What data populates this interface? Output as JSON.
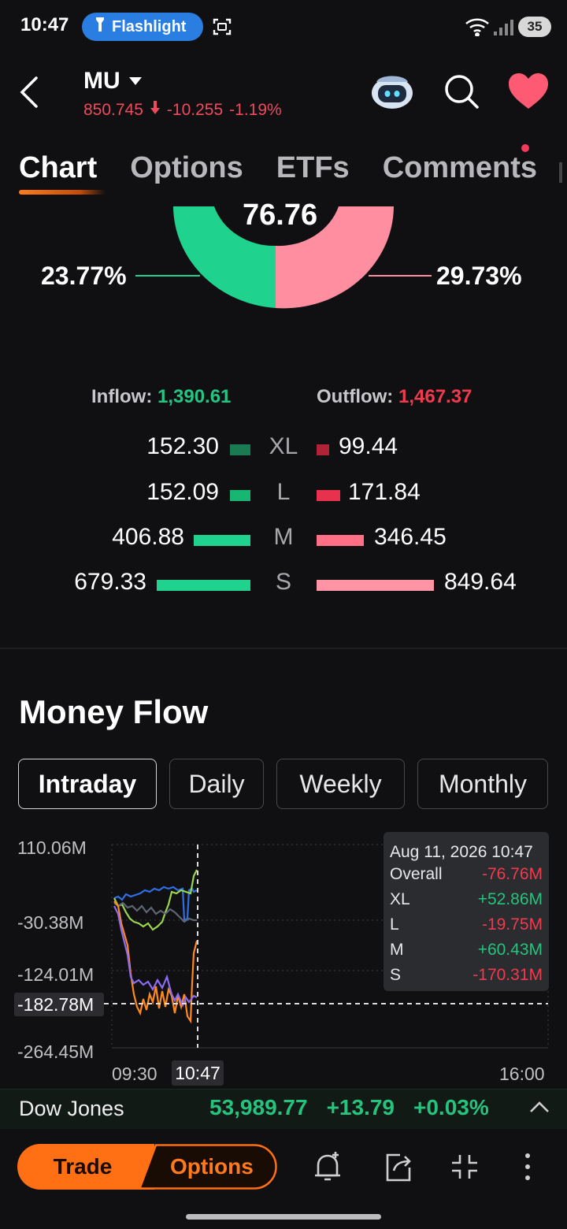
{
  "status_bar": {
    "time": "10:47",
    "flashlight_label": "Flashlight",
    "battery": "35"
  },
  "header": {
    "ticker": "MU",
    "price": "850.745",
    "change": "-10.255",
    "change_pct": "-1.19%",
    "icons": [
      "back-arrow-icon",
      "robot-assistant-icon",
      "search-icon",
      "heart-icon"
    ]
  },
  "tabs": [
    {
      "label": "Chart",
      "active": true
    },
    {
      "label": "Options",
      "active": false
    },
    {
      "label": "ETFs",
      "active": false
    },
    {
      "label": "Comments",
      "active": false,
      "badge": true
    }
  ],
  "donut": {
    "center_value": "76.76",
    "inflow_pct": "23.77%",
    "outflow_pct": "29.73%"
  },
  "flow_summary": {
    "inflow_label": "Inflow:",
    "inflow_value": "1,390.61",
    "outflow_label": "Outflow:",
    "outflow_value": "1,467.37",
    "rows": [
      {
        "size": "XL",
        "inflow": "152.30",
        "outflow": "99.44",
        "inflow_num": 152.3,
        "outflow_num": 99.44
      },
      {
        "size": "L",
        "inflow": "152.09",
        "outflow": "171.84",
        "inflow_num": 152.09,
        "outflow_num": 171.84
      },
      {
        "size": "M",
        "inflow": "406.88",
        "outflow": "346.45",
        "inflow_num": 406.88,
        "outflow_num": 346.45
      },
      {
        "size": "S",
        "inflow": "679.33",
        "outflow": "849.64",
        "inflow_num": 679.33,
        "outflow_num": 849.64
      }
    ]
  },
  "money_flow": {
    "title": "Money Flow",
    "periods": [
      {
        "label": "Intraday",
        "active": true
      },
      {
        "label": "Daily",
        "active": false
      },
      {
        "label": "Weekly",
        "active": false
      },
      {
        "label": "Monthly",
        "active": false
      }
    ],
    "y_labels": [
      "110.06M",
      "-30.38M",
      "-124.01M",
      "-182.78M",
      "-264.45M"
    ],
    "x_labels": [
      "09:30",
      "10:47",
      "16:00"
    ],
    "tooltip": {
      "date": "Aug 11, 2026 10:47",
      "rows": [
        {
          "label": "Overall",
          "value": "-76.76M",
          "color": "#f03a4e"
        },
        {
          "label": "XL",
          "value": "+52.86M",
          "color": "#25c37e"
        },
        {
          "label": "L",
          "value": "-19.75M",
          "color": "#f03a4e"
        },
        {
          "label": "M",
          "value": "+60.43M",
          "color": "#25c37e"
        },
        {
          "label": "S",
          "value": "-170.31M",
          "color": "#f03a4e"
        }
      ]
    }
  },
  "index_bar": {
    "name": "Dow Jones",
    "value": "53,989.77",
    "change": "+13.79",
    "change_pct": "+0.03%"
  },
  "toolbar": {
    "trade_label": "Trade",
    "options_label": "Options",
    "icons": [
      "bell-plus-icon",
      "share-icon",
      "collapse-icon",
      "more-vertical-icon"
    ]
  },
  "colors": {
    "up": "#25c37e",
    "down": "#f03a4e",
    "accent": "#ff6f13"
  }
}
